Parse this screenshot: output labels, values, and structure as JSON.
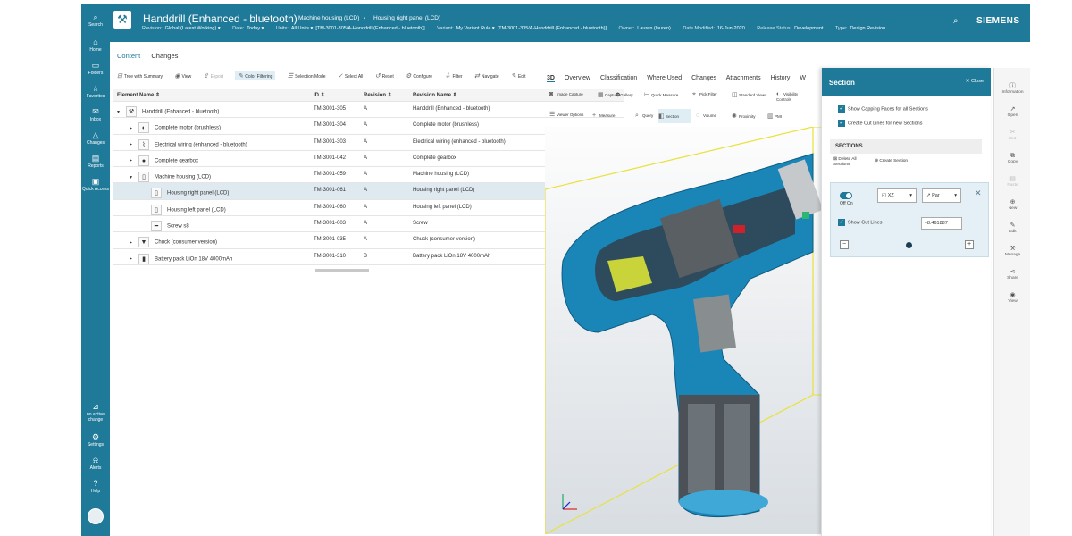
{
  "nav": {
    "items": [
      {
        "label": "Search",
        "icon": "⌕"
      },
      {
        "label": "Home",
        "icon": "⌂"
      },
      {
        "label": "Folders",
        "icon": "▭"
      },
      {
        "label": "Favorites",
        "icon": "☆"
      },
      {
        "label": "Inbox",
        "icon": "✉"
      },
      {
        "label": "Changes",
        "icon": "△"
      },
      {
        "label": "Reports",
        "icon": "▤"
      },
      {
        "label": "Quick Access",
        "icon": "▣"
      }
    ],
    "bottom": [
      {
        "label": "no active change",
        "icon": "⊿"
      },
      {
        "label": "Settings",
        "icon": "⚙"
      },
      {
        "label": "Alerts",
        "icon": "⍾"
      },
      {
        "label": "Help",
        "icon": "?"
      }
    ]
  },
  "header": {
    "title": "Handdrill (Enhanced - bluetooth)",
    "breadcrumb": [
      "Machine housing (LCD)",
      "Housing right panel (LCD)"
    ],
    "props": [
      {
        "k": "Revision:",
        "v": "Global (Latest Working) ▾"
      },
      {
        "k": "Date:",
        "v": "Today ▾"
      },
      {
        "k": "Units:",
        "v": "All Units ▾"
      },
      {
        "k": "",
        "v": "[TM-3001-305/A-Handdrill (Enhanced - bluetooth)]"
      },
      {
        "k": "Variant:",
        "v": "My Variant Rule ▾"
      },
      {
        "k": "",
        "v": "[TM-3001-305/A-Handdrill (Enhanced - bluetooth)]"
      },
      {
        "k": "Owner:",
        "v": "Lauren (lauren)"
      },
      {
        "k": "Date Modified:",
        "v": "16-Jun-2020"
      },
      {
        "k": "Release Status:",
        "v": "Development"
      },
      {
        "k": "Type:",
        "v": "Design Revision"
      }
    ],
    "brand": "SIEMENS"
  },
  "tabs": [
    "Content",
    "Changes"
  ],
  "toolbar": [
    "Tree with Summary",
    "View",
    "Export",
    "Color Filtering",
    "Selection Mode",
    "Select All",
    "Reset",
    "Configure",
    "Filter",
    "Navigate",
    "Edit"
  ],
  "table": {
    "headers": [
      "Element Name ⇕",
      "ID ⇕",
      "Revision ⇕",
      "Revision Name ⇕"
    ],
    "rows": [
      {
        "name": "Handdrill (Enhanced - bluetooth)",
        "id": "TM-3001-305",
        "rev": "A",
        "rname": "Handdrill (Enhanced - bluetooth)",
        "exp": "▾",
        "indent": 0
      },
      {
        "name": "Complete motor (brushless)",
        "id": "TM-3001-304",
        "rev": "A",
        "rname": "Complete motor (brushless)",
        "exp": "▸",
        "indent": 1
      },
      {
        "name": "Electrical wiring (enhanced - bluetooth)",
        "id": "TM-3001-303",
        "rev": "A",
        "rname": "Electrical wiring (enhanced - bluetooth)",
        "exp": "▸",
        "indent": 1
      },
      {
        "name": "Complete gearbox",
        "id": "TM-3001-042",
        "rev": "A",
        "rname": "Complete gearbox",
        "exp": "▸",
        "indent": 1
      },
      {
        "name": "Machine housing (LCD)",
        "id": "TM-3001-059",
        "rev": "A",
        "rname": "Machine housing (LCD)",
        "exp": "▾",
        "indent": 1
      },
      {
        "name": "Housing right panel (LCD)",
        "id": "TM-3001-061",
        "rev": "A",
        "rname": "Housing right panel (LCD)",
        "exp": "",
        "indent": 2
      },
      {
        "name": "Housing left panel (LCD)",
        "id": "TM-3001-060",
        "rev": "A",
        "rname": "Housing left panel (LCD)",
        "exp": "",
        "indent": 2
      },
      {
        "name": "Screw s8",
        "id": "TM-3001-003",
        "rev": "A",
        "rname": "Screw",
        "exp": "",
        "indent": 2
      },
      {
        "name": "Chuck (consumer version)",
        "id": "TM-3001-035",
        "rev": "A",
        "rname": "Chuck (consumer version)",
        "exp": "▸",
        "indent": 1
      },
      {
        "name": "Battery pack LiOn 18V 4000mAh",
        "id": "TM-3001-310",
        "rev": "B",
        "rname": "Battery pack LiOn 18V 4000mAh",
        "exp": "▸",
        "indent": 1
      }
    ]
  },
  "tabs3d": [
    "3D",
    "Overview",
    "Classification",
    "Where Used",
    "Changes",
    "Attachments",
    "History",
    "W"
  ],
  "toolbar3d": [
    "Image Capture",
    "Capture Gallery",
    "Quick Measure",
    "Pick Filter",
    "Standard Views",
    "Visibility Controls",
    "Viewer Options",
    "Measure",
    "Query",
    "Section",
    "Volume",
    "Proximity",
    "PMI"
  ],
  "section": {
    "title": "Section",
    "close": "Close",
    "opt1": "Show Capping Faces for all Sections",
    "opt2": "Create Cut Lines for new Sections",
    "sections_label": "SECTIONS",
    "delete_all": "Delete All Sections",
    "create": "Create Section",
    "toggle_label": "Off  On",
    "plane": "XZ",
    "dir": "Par",
    "show_cut": "Show Cut Lines",
    "value": "-8.461887"
  },
  "rail": [
    "Information",
    "Open",
    "Cut",
    "Copy",
    "Paste",
    "New",
    "Edit",
    "Manage",
    "Share",
    "View"
  ],
  "colors": {
    "accent": "#1f7a99",
    "model": "#1a86b8"
  }
}
